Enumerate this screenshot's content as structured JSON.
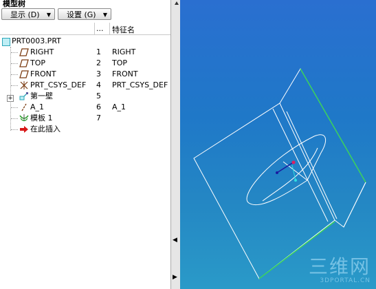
{
  "panel": {
    "title": "模型树",
    "show_button": "显示 (D)",
    "settings_button": "设置 (G)",
    "columns": {
      "dots": "...",
      "feature_name": "特征名"
    }
  },
  "tree": {
    "root": "PRT0003.PRT",
    "items": [
      {
        "name": "RIGHT",
        "num": "1",
        "feature": "RIGHT",
        "icon": "datum-plane-icon"
      },
      {
        "name": "TOP",
        "num": "2",
        "feature": "TOP",
        "icon": "datum-plane-icon"
      },
      {
        "name": "FRONT",
        "num": "3",
        "feature": "FRONT",
        "icon": "datum-plane-icon"
      },
      {
        "name": "PRT_CSYS_DEF",
        "num": "4",
        "feature": "PRT_CSYS_DEF",
        "icon": "csys-icon"
      },
      {
        "name": "第一壁",
        "num": "5",
        "feature": "",
        "icon": "first-wall-icon"
      },
      {
        "name": "A_1",
        "num": "6",
        "feature": "A_1",
        "icon": "axis-icon"
      },
      {
        "name": "模板 1",
        "num": "7",
        "feature": "",
        "icon": "form-icon"
      },
      {
        "name": "在此插入",
        "num": "",
        "feature": "",
        "icon": "insert-here-arrow-icon"
      }
    ]
  },
  "watermark": {
    "text": "三维网",
    "url": "3DPORTAL.CN"
  },
  "colors": {
    "viewport_bg": "#2a7cc8",
    "edge_green": "#3ad25a",
    "insert_arrow": "#d81818"
  }
}
